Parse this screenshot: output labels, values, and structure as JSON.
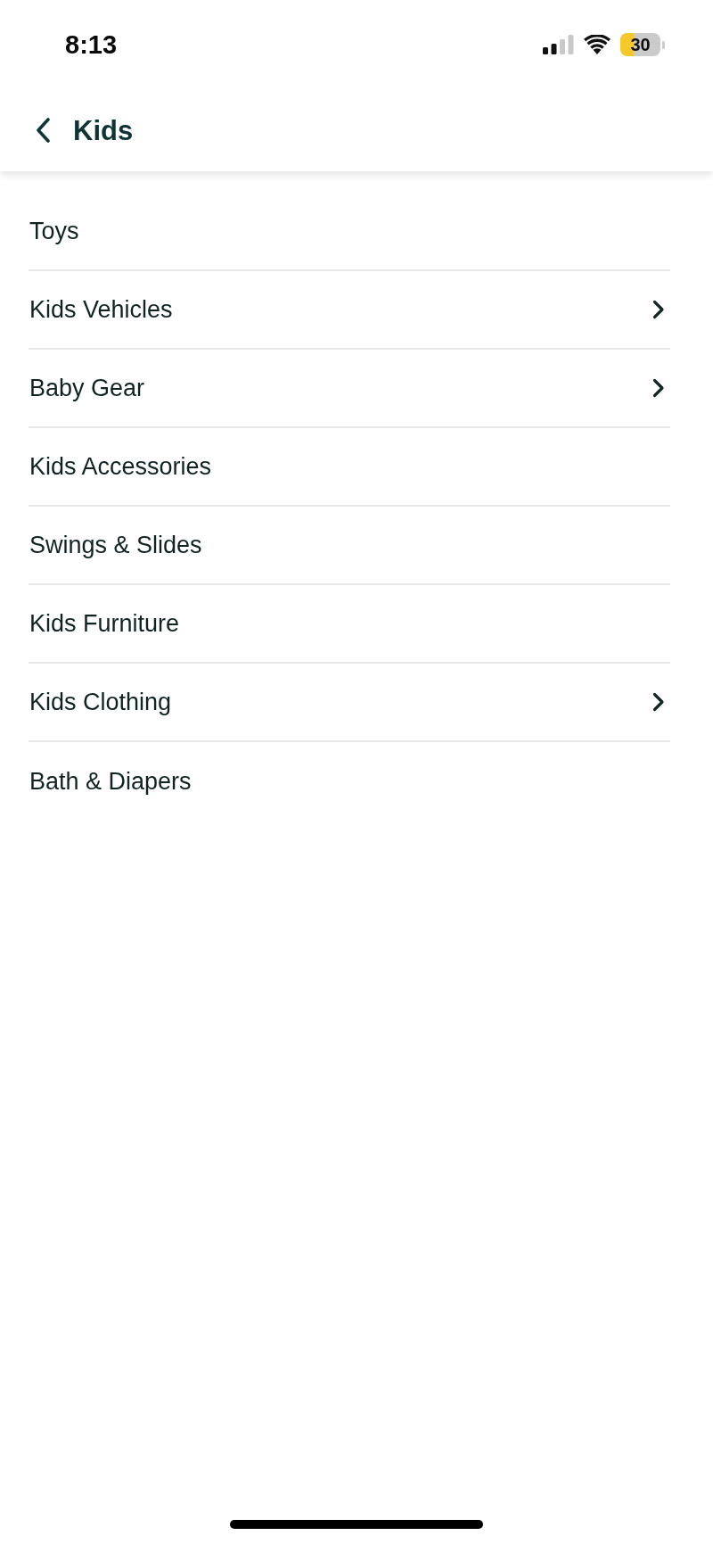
{
  "status_bar": {
    "time": "8:13",
    "battery": "30"
  },
  "header": {
    "title": "Kids"
  },
  "categories": [
    {
      "label": "Toys",
      "has_subcategories": false
    },
    {
      "label": "Kids Vehicles",
      "has_subcategories": true
    },
    {
      "label": "Baby Gear",
      "has_subcategories": true
    },
    {
      "label": "Kids Accessories",
      "has_subcategories": false
    },
    {
      "label": "Swings & Slides",
      "has_subcategories": false
    },
    {
      "label": "Kids Furniture",
      "has_subcategories": false
    },
    {
      "label": "Kids Clothing",
      "has_subcategories": true
    },
    {
      "label": "Bath & Diapers",
      "has_subcategories": false
    }
  ]
}
